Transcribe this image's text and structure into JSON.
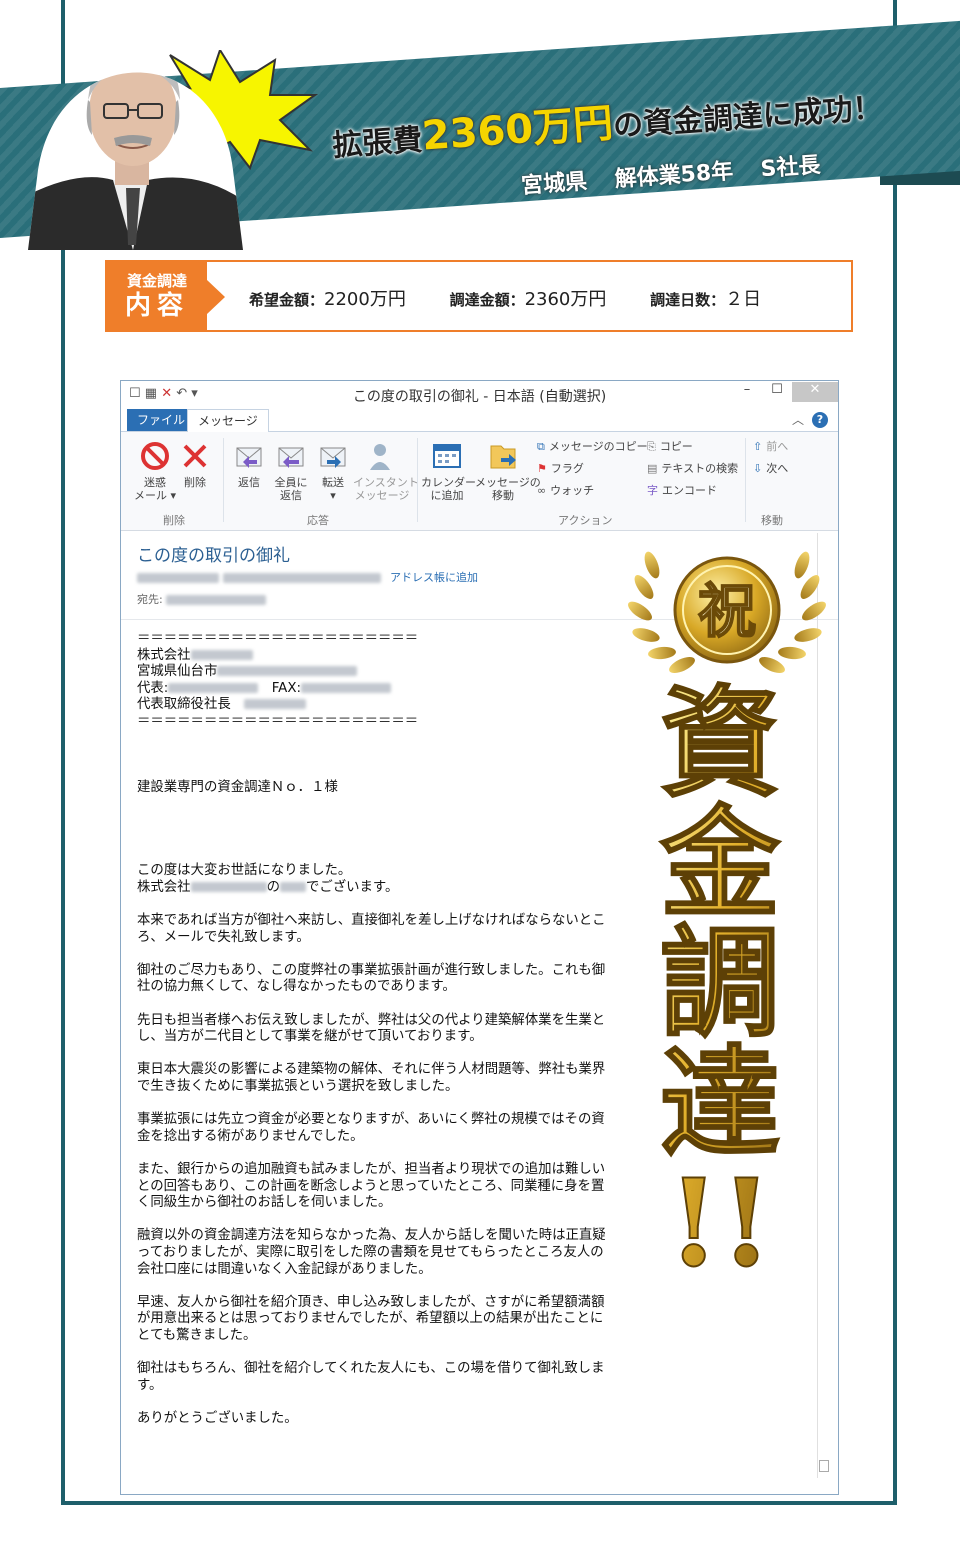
{
  "banner": {
    "prefix": "拡張費",
    "amount": "2360万円",
    "suffix": "の資金調達に成功！",
    "region": "宮城県",
    "industry": "解体業58年",
    "person": "S社長"
  },
  "info": {
    "tag_top": "資金調達",
    "tag_bottom": "内容",
    "desired_label": "希望金額：",
    "desired_value": "2200万円",
    "raised_label": "調達金額：",
    "raised_value": "2360万円",
    "days_label": "調達日数：",
    "days_value": "２日"
  },
  "window": {
    "title": "この度の取引の御礼 - 日本語 (自動選択)",
    "tab_file": "ファイル",
    "tab_message": "メッセージ",
    "ribbon": {
      "junk": "迷惑\nメール ▾",
      "delete": "削除",
      "reply": "返信",
      "reply_all": "全員に\n返信",
      "forward": "転送\n▾",
      "im": "インスタント\nメッセージ",
      "calendar": "カレンダー\nに追加",
      "move": "メッセージの\n移動",
      "copy_msg": "メッセージのコピー",
      "flag": "フラグ",
      "watch": "ウォッチ",
      "copy": "コピー",
      "find": "テキストの検索",
      "encode": "エンコード",
      "prev": "前へ",
      "next": "次へ",
      "group_delete": "削除",
      "group_reply": "応答",
      "group_action": "アクション",
      "group_move": "移動"
    },
    "subject": "この度の取引の御礼",
    "add_address": "アドレス帳に追加",
    "to_label": "宛先:"
  },
  "email": {
    "rule": "＝＝＝＝＝＝＝＝＝＝＝＝＝＝＝＝＝＝＝＝＝",
    "company": "株式会社",
    "address": "宮城県仙台市",
    "tel": "代表:",
    "fax": "FAX:",
    "ceo": "代表取締役社長",
    "greeting_to": "建設業専門の資金調達Ｎｏ．１様",
    "p1": "この度は大変お世話になりました。",
    "p1b_a": "株式会社",
    "p1b_b": "の",
    "p1b_c": "でございます。",
    "p2": "本来であれば当方が御社へ来訪し、直接御礼を差し上げなければならないところ、メールで失礼致します。",
    "p3": "御社のご尽力もあり、この度弊社の事業拡張計画が進行致しました。これも御社の協力無くして、なし得なかったものであります。",
    "p4": "先日も担当者様へお伝え致しましたが、弊社は父の代より建築解体業を生業とし、当方が二代目として事業を継がせて頂いております。",
    "p5": "東日本大震災の影響による建築物の解体、それに伴う人材問題等、弊社も業界で生き抜くために事業拡張という選択を致しました。",
    "p6": "事業拡張には先立つ資金が必要となりますが、あいにく弊社の規模ではその資金を捻出する術がありませんでした。",
    "p7": "また、銀行からの追加融資も試みましたが、担当者より現状での追加は難しいとの回答もあり、この計画を断念しようと思っていたところ、同業種に身を置く同級生から御社のお話しを伺いました。",
    "p8": "融資以外の資金調達方法を知らなかった為、友人から話しを聞いた時は正直疑っておりましたが、実際に取引をした際の書類を見せてもらったところ友人の会社口座には間違いなく入金記録がありました。",
    "p9": "早速、友人から御社を紹介頂き、申し込み致しましたが、さすがに希望額満額が用意出来るとは思っておりませんでしたが、希望額以上の結果が出たことにとても驚きました。",
    "p10": "御社はもちろん、御社を紹介してくれた友人にも、この場を借りて御礼致します。",
    "p11": "ありがとうございました。"
  },
  "seal": {
    "medal": "祝",
    "vertical": "資金調達!!"
  },
  "colors": {
    "teal": "#2a6f7a",
    "orange": "#ef7e2a",
    "gold": "#d8a826",
    "outlook_blue": "#2b6fb4"
  }
}
